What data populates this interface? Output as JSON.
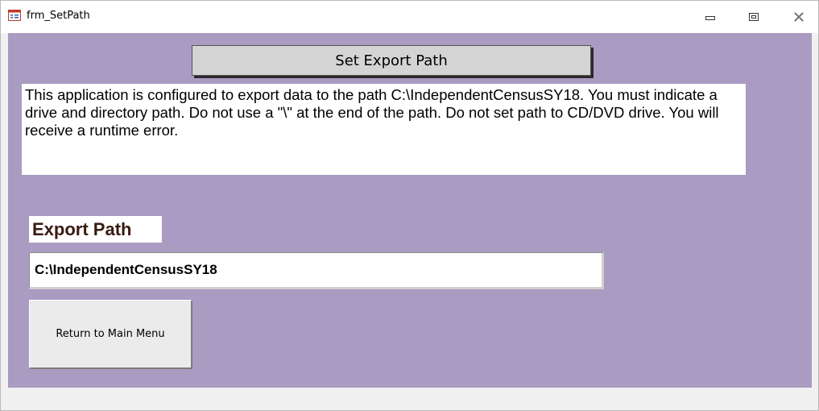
{
  "window": {
    "title": "frm_SetPath",
    "controls": {
      "minimize": "minimize-icon",
      "restore": "restore-icon",
      "close": "close-icon"
    }
  },
  "form": {
    "header_label": "Set Export Path",
    "info_text": "This application is configured to export data to the path C:\\IndependentCensusSY18. You must indicate a drive and directory path. Do not use a \"\\\" at the end of the path. Do not set path to CD/DVD drive. You will receive a runtime error.",
    "export_path_label": "Export Path",
    "export_path_value": "C:\\IndependentCensusSY18",
    "return_button_label": "Return to Main Menu"
  },
  "colors": {
    "form_background": "#a99bc1",
    "header_button": "#d4d4d4",
    "label_text": "#3a1a10"
  }
}
